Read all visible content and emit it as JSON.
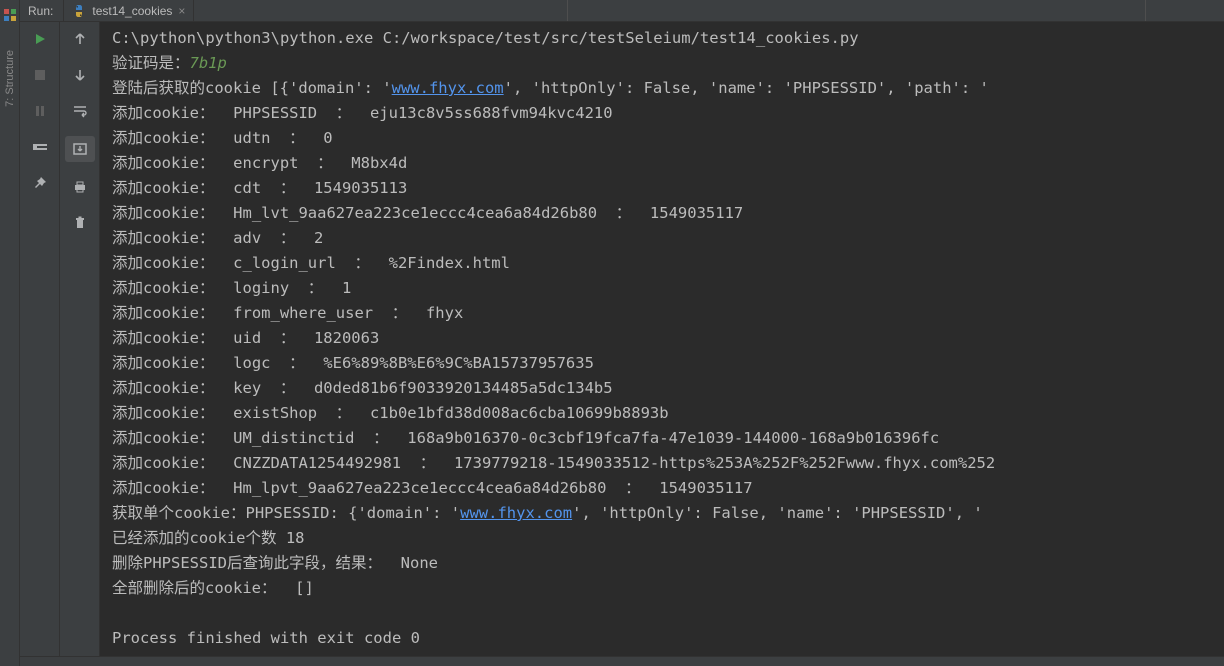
{
  "panel_label": "Run:",
  "structure_label": "7: Structure",
  "tab": {
    "name": "test14_cookies"
  },
  "console": {
    "cmd": "C:\\python\\python3\\python.exe C:/workspace/test/src/testSeleium/test14_cookies.py",
    "captcha_prefix": "验证码是：",
    "captcha": "7b1p",
    "after_login_pre": "登陆后获取的cookie [{'domain': '",
    "link1": "www.fhyx.com",
    "after_login_post": "', 'httpOnly': False, 'name': 'PHPSESSID', 'path': '",
    "adds": [
      "添加cookie：  PHPSESSID  ：  eju13c8v5ss688fvm94kvc4210",
      "添加cookie：  udtn  ：  0",
      "添加cookie：  encrypt  ：  M8bx4d",
      "添加cookie：  cdt  ：  1549035113",
      "添加cookie：  Hm_lvt_9aa627ea223ce1eccc4cea6a84d26b80  ：  1549035117",
      "添加cookie：  adv  ：  2",
      "添加cookie：  c_login_url  ：  %2Findex.html",
      "添加cookie：  loginy  ：  1",
      "添加cookie：  from_where_user  ：  fhyx",
      "添加cookie：  uid  ：  1820063",
      "添加cookie：  logc  ：  %E6%89%8B%E6%9C%BA15737957635",
      "添加cookie：  key  ：  d0ded81b6f9033920134485a5dc134b5",
      "添加cookie：  existShop  ：  c1b0e1bfd38d008ac6cba10699b8893b",
      "添加cookie：  UM_distinctid  ：  168a9b016370-0c3cbf19fca7fa-47e1039-144000-168a9b016396fc",
      "添加cookie：  CNZZDATA1254492981  ：  1739779218-1549033512-https%253A%252F%252Fwww.fhyx.com%252",
      "添加cookie：  Hm_lpvt_9aa627ea223ce1eccc4cea6a84d26b80  ：  1549035117"
    ],
    "single_pre": "获取单个cookie：PHPSESSID: {'domain': '",
    "link2": "www.fhyx.com",
    "single_post": "', 'httpOnly': False, 'name': 'PHPSESSID', '",
    "added_count": "已经添加的cookie个数 18",
    "deleted_query": "删除PHPSESSID后查询此字段，结果：  None",
    "all_deleted": "全部删除后的cookie：  []",
    "exit": "Process finished with exit code 0"
  }
}
